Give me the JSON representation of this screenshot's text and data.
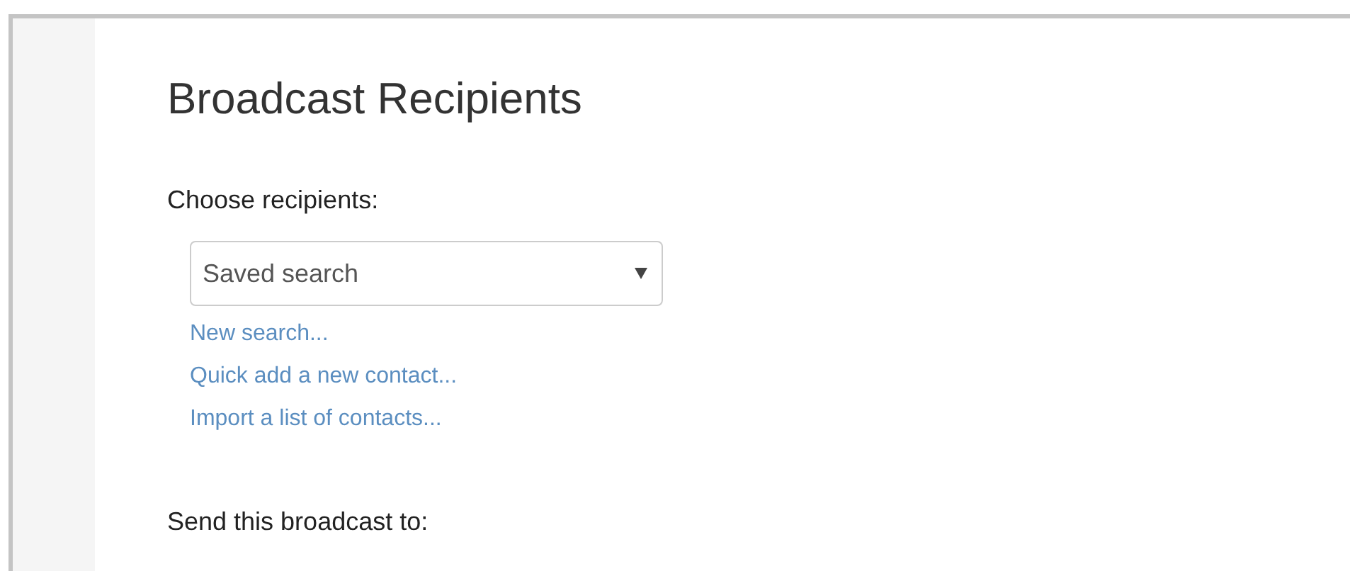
{
  "title": "Broadcast Recipients",
  "choose_label": "Choose recipients:",
  "recipient_select": {
    "value": "Saved search"
  },
  "links": [
    "New search...",
    "Quick add a new contact...",
    "Import a list of contacts..."
  ],
  "send_label": "Send this broadcast to:"
}
